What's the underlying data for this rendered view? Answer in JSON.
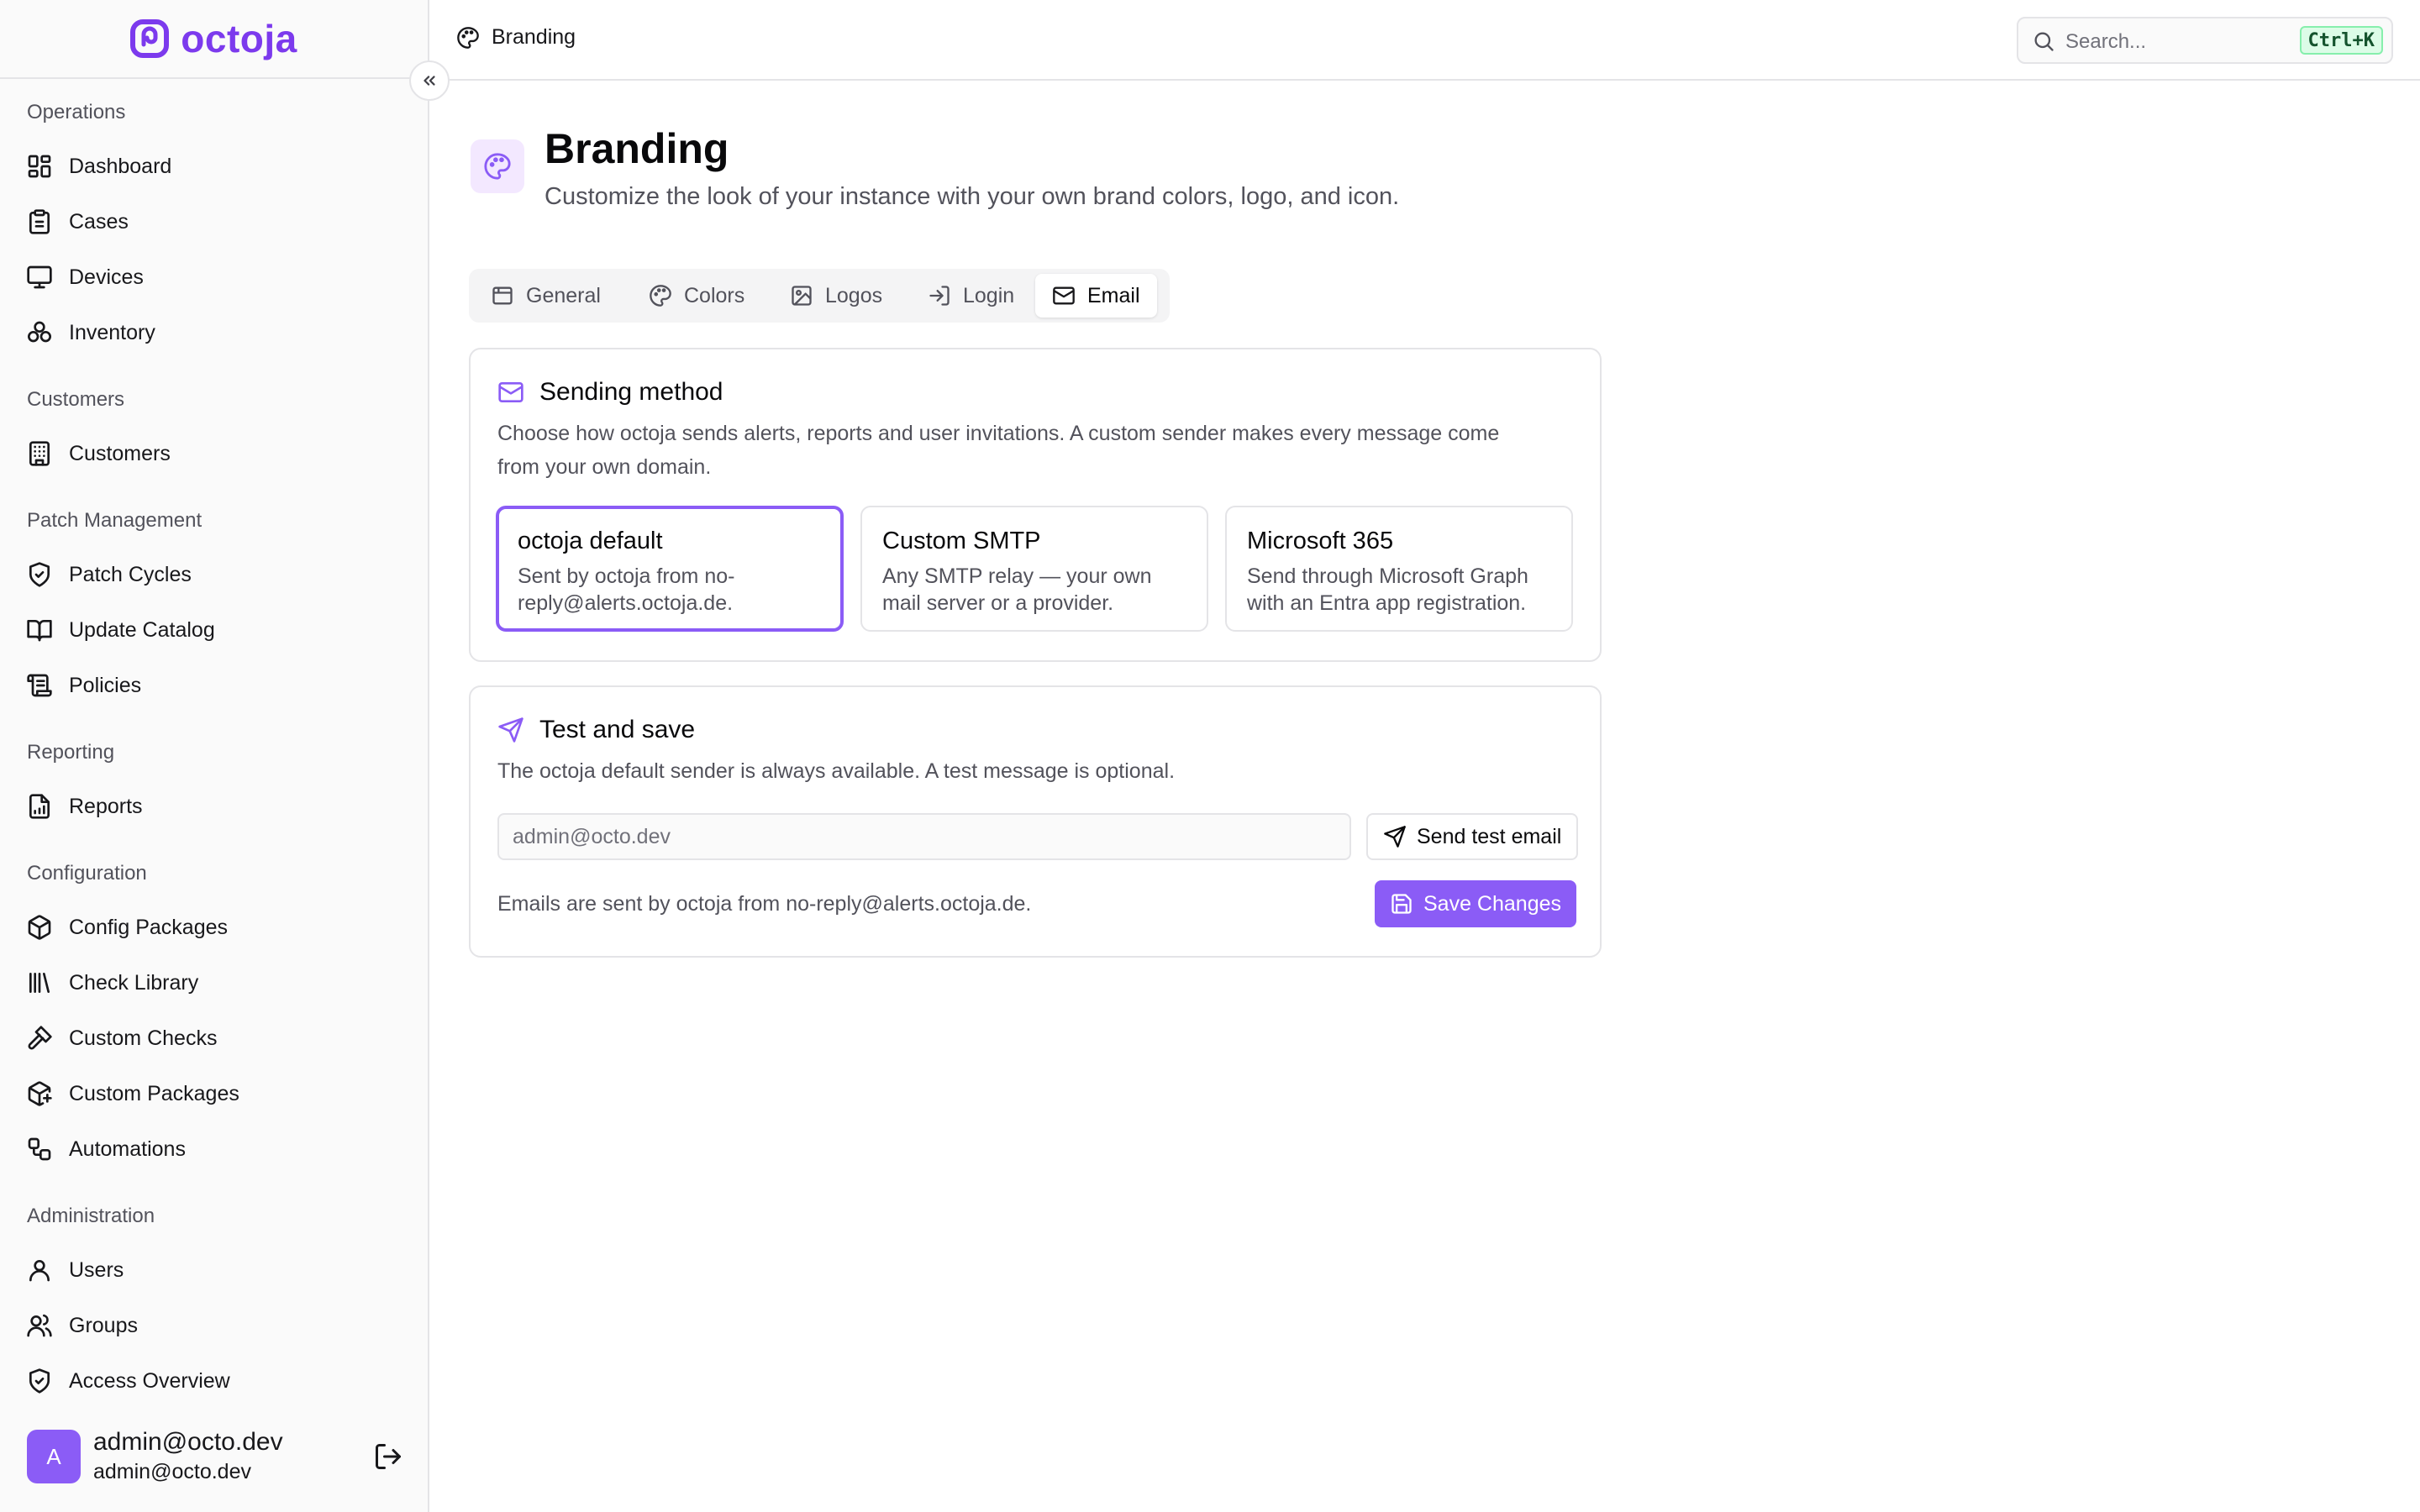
{
  "app": {
    "name": "octoja",
    "accent": "#8b5cf6",
    "logo_color": "#7c3aed"
  },
  "sidebar": {
    "sections": [
      {
        "label": "Operations",
        "items": [
          {
            "label": "Dashboard",
            "icon": "dashboard-icon"
          },
          {
            "label": "Cases",
            "icon": "clipboard-icon"
          },
          {
            "label": "Devices",
            "icon": "monitor-icon"
          },
          {
            "label": "Inventory",
            "icon": "boxes-icon"
          }
        ]
      },
      {
        "label": "Customers",
        "items": [
          {
            "label": "Customers",
            "icon": "building-icon"
          }
        ]
      },
      {
        "label": "Patch Management",
        "items": [
          {
            "label": "Patch Cycles",
            "icon": "shield-icon"
          },
          {
            "label": "Update Catalog",
            "icon": "book-icon"
          },
          {
            "label": "Policies",
            "icon": "scroll-icon"
          }
        ]
      },
      {
        "label": "Reporting",
        "items": [
          {
            "label": "Reports",
            "icon": "report-icon"
          }
        ]
      },
      {
        "label": "Configuration",
        "items": [
          {
            "label": "Config Packages",
            "icon": "package-icon"
          },
          {
            "label": "Check Library",
            "icon": "library-icon"
          },
          {
            "label": "Custom Checks",
            "icon": "hammer-icon"
          },
          {
            "label": "Custom Packages",
            "icon": "package-plus-icon"
          },
          {
            "label": "Automations",
            "icon": "workflow-icon"
          }
        ]
      },
      {
        "label": "Administration",
        "items": [
          {
            "label": "Users",
            "icon": "user-icon"
          },
          {
            "label": "Groups",
            "icon": "users-icon"
          },
          {
            "label": "Access Overview",
            "icon": "shield-check-icon"
          }
        ]
      }
    ],
    "user": {
      "initial": "A",
      "name": "admin@octo.dev",
      "email": "admin@octo.dev"
    }
  },
  "topbar": {
    "breadcrumb": "Branding",
    "search_placeholder": "Search...",
    "shortcut": "Ctrl+K"
  },
  "page": {
    "title": "Branding",
    "subtitle": "Customize the look of your instance with your own brand colors, logo, and icon."
  },
  "tabs": [
    {
      "label": "General",
      "icon": "window-icon",
      "active": false
    },
    {
      "label": "Colors",
      "icon": "palette-icon",
      "active": false
    },
    {
      "label": "Logos",
      "icon": "image-icon",
      "active": false
    },
    {
      "label": "Login",
      "icon": "login-icon",
      "active": false
    },
    {
      "label": "Email",
      "icon": "mail-icon",
      "active": true
    }
  ],
  "sending": {
    "title": "Sending method",
    "desc_line1": "Choose how octoja sends alerts, reports and user invitations. A custom sender makes every message come",
    "desc_line2": "from your own domain.",
    "options": [
      {
        "title": "octoja default",
        "desc": "Sent by octoja from no-reply@alerts.octoja.de.",
        "selected": true
      },
      {
        "title": "Custom SMTP",
        "desc": "Any SMTP relay — your own mail server or a provider.",
        "selected": false
      },
      {
        "title": "Microsoft 365",
        "desc": "Send through Microsoft Graph with an Entra app registration.",
        "selected": false
      }
    ]
  },
  "test": {
    "title": "Test and save",
    "desc": "The octoja default sender is always available. A test message is optional.",
    "email_value": "admin@octo.dev",
    "send_label": "Send test email",
    "note": "Emails are sent by octoja from no-reply@alerts.octoja.de.",
    "save_label": "Save Changes"
  }
}
